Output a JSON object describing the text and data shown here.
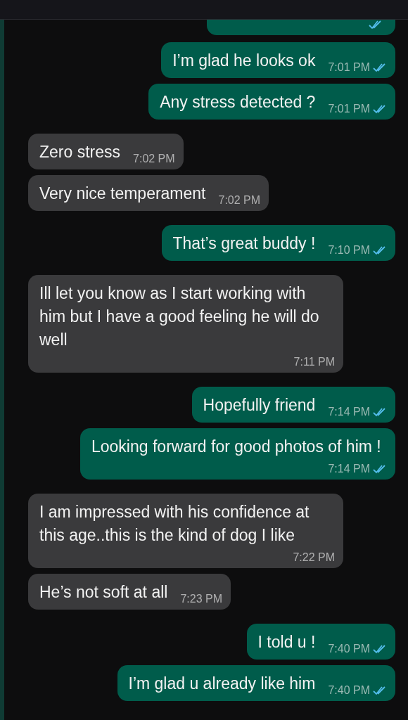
{
  "cut_message": {
    "kind": "outgoing",
    "read": true
  },
  "messages": [
    {
      "kind": "outgoing",
      "text": "I’m glad he looks ok",
      "time": "7:01 PM",
      "read": true
    },
    {
      "kind": "outgoing",
      "text": "Any stress detected ?",
      "time": "7:01 PM",
      "read": true
    },
    {
      "kind": "incoming",
      "text": "Zero stress",
      "time": "7:02 PM"
    },
    {
      "kind": "incoming",
      "text": "Very nice temperament",
      "time": "7:02 PM"
    },
    {
      "kind": "outgoing",
      "text": "That’s great buddy !",
      "time": "7:10 PM",
      "read": true
    },
    {
      "kind": "incoming",
      "text": "Ill let you know as I start working with him but I have a good feeling he will do well",
      "time": "7:11 PM"
    },
    {
      "kind": "outgoing",
      "text": "Hopefully friend",
      "time": "7:14 PM",
      "read": true
    },
    {
      "kind": "outgoing",
      "text": "Looking forward for good photos of him !",
      "time": "7:14 PM",
      "read": true
    },
    {
      "kind": "incoming",
      "text": "I am impressed with his confidence at this age..this is the kind of dog I like",
      "time": "7:22 PM"
    },
    {
      "kind": "incoming",
      "text": "He’s not soft at all",
      "time": "7:23 PM"
    },
    {
      "kind": "outgoing",
      "text": "I told u !",
      "time": "7:40 PM",
      "read": true
    },
    {
      "kind": "outgoing",
      "text": "I’m glad u already like him",
      "time": "7:40 PM",
      "read": true
    }
  ]
}
